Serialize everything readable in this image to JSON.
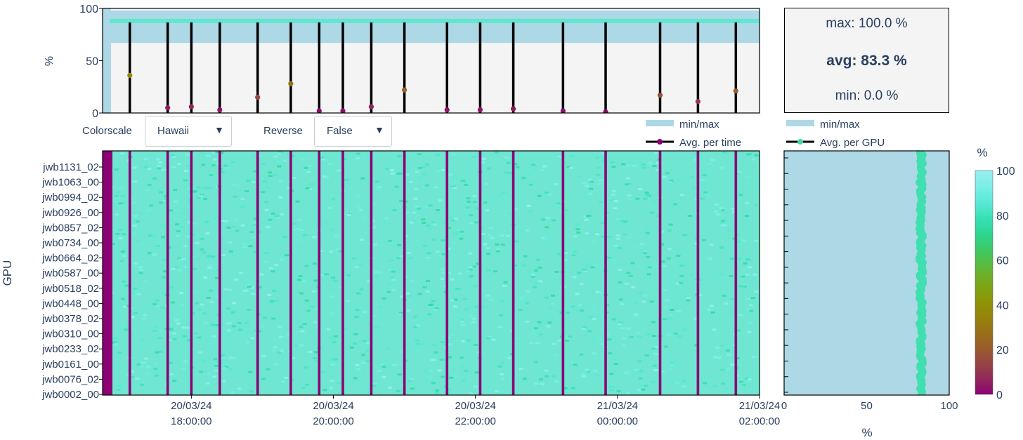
{
  "controls": {
    "colorscale_label": "Colorscale",
    "colorscale_value": "Hawaii",
    "reverse_label": "Reverse",
    "reverse_value": "False",
    "dropdown_icon": "triangle-down-icon"
  },
  "stats": {
    "max": "max: 100.0 %",
    "avg": "avg: 83.3 %",
    "min": "min: 0.0 %"
  },
  "legends": {
    "time_minmax": "min/max",
    "time_avg": "Avg. per time",
    "gpu_minmax": "min/max",
    "gpu_avg": "Avg. per GPU"
  },
  "colors": {
    "band": "#add8e6",
    "avg_line": "#00e5c0",
    "panel_bg": "#f4f4f4",
    "low": "#8c0273",
    "high": "#96f0f0"
  },
  "chart_data": [
    {
      "type": "area",
      "panel": "utilization-over-time",
      "ylabel": "%",
      "ylim": [
        0,
        100
      ],
      "yticks": [
        "0",
        "50",
        "100"
      ],
      "series": [
        {
          "name": "min/max",
          "band": true,
          "typical_min": 67,
          "typical_max": 98
        },
        {
          "name": "Avg. per time",
          "typical_value": 88
        }
      ],
      "drop_times": [
        "17:08",
        "17:40",
        "18:00",
        "18:24",
        "18:56",
        "19:24",
        "19:48",
        "20:08",
        "20:32",
        "21:00",
        "21:36",
        "22:04",
        "22:32",
        "23:14",
        "23:50",
        "00:36",
        "01:08",
        "01:40"
      ],
      "drop_avg_values": [
        36,
        5,
        6,
        3,
        15,
        28,
        2,
        2,
        6,
        22,
        3,
        3,
        4,
        2,
        1,
        17,
        11,
        21
      ]
    },
    {
      "type": "heatmap",
      "panel": "utilization-per-gpu-and-time",
      "xlabel": "",
      "ylabel": "GPU",
      "x_ticks": [
        {
          "date": "20/03/24",
          "time": "18:00:00"
        },
        {
          "date": "20/03/24",
          "time": "20:00:00"
        },
        {
          "date": "20/03/24",
          "time": "22:00:00"
        },
        {
          "date": "21/03/24",
          "time": "00:00:00"
        },
        {
          "date": "21/03/24",
          "time": "02:00:00"
        }
      ],
      "x_range": [
        "20/03/24 16:45",
        "21/03/24 02:00"
      ],
      "y_ticks": [
        "jwb1131_02",
        "jwb1063_00",
        "jwb0994_02",
        "jwb0926_00",
        "jwb0857_02",
        "jwb0734_00",
        "jwb0664_02",
        "jwb0587_00",
        "jwb0518_02",
        "jwb0448_00",
        "jwb0378_02",
        "jwb0310_00",
        "jwb0233_02",
        "jwb0161_00",
        "jwb0076_02",
        "jwb0002_00"
      ],
      "zlim": [
        0,
        100
      ],
      "typical_value": 88,
      "drop_times": [
        "17:08",
        "17:40",
        "18:00",
        "18:24",
        "18:56",
        "19:24",
        "19:48",
        "20:08",
        "20:32",
        "21:00",
        "21:36",
        "22:04",
        "22:32",
        "23:14",
        "23:50",
        "00:36",
        "01:08",
        "01:40"
      ]
    },
    {
      "type": "area",
      "panel": "utilization-per-gpu",
      "xlabel": "%",
      "xlim": [
        0,
        100
      ],
      "xticks": [
        "0",
        "50",
        "100"
      ],
      "series": [
        {
          "name": "min/max",
          "band": true,
          "min": 0,
          "max": 100
        },
        {
          "name": "Avg. per GPU",
          "typical_value": 83
        }
      ]
    },
    {
      "type": "colorbar",
      "title": "%",
      "ticks": [
        "0",
        "20",
        "40",
        "60",
        "80",
        "100"
      ],
      "colors": [
        "#8c0273",
        "#922a59",
        "#964742",
        "#995f2b",
        "#997217",
        "#958609",
        "#8a9808",
        "#78a81a",
        "#5eb83b",
        "#3fc863",
        "#2cd58e",
        "#37e0b6",
        "#5ae9d4",
        "#7aeee5",
        "#96f0f0"
      ]
    }
  ]
}
